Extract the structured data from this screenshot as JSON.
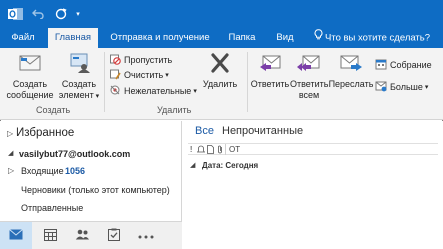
{
  "ribbon_tabs": [
    {
      "label": "Файл"
    },
    {
      "label": "Главная"
    },
    {
      "label": "Отправка и получение"
    },
    {
      "label": "Папка"
    },
    {
      "label": "Вид"
    }
  ],
  "tell_me": "Что вы хотите сделать?",
  "groups": {
    "create": {
      "label": "Создать",
      "new_message_line1": "Создать",
      "new_message_line2": "сообщение",
      "new_item_line1": "Создать",
      "new_item_line2": "элемент"
    },
    "delete": {
      "label": "Удалить",
      "ignore": "Пропустить",
      "clean_up": "Очистить",
      "junk": "Нежелательные",
      "delete": "Удалить"
    },
    "respond": {
      "reply": "Ответить",
      "reply_all_line1": "Ответить",
      "reply_all_line2": "всем",
      "forward": "Переслать",
      "meeting": "Собрание",
      "more": "Больше"
    }
  },
  "nav": {
    "favorites": "Избранное",
    "account": "vasilybut77@outlook.com",
    "inbox": "Входящие",
    "inbox_count": "1056",
    "drafts": "Черновики (только этот компьютер)",
    "sent": "Отправленные"
  },
  "list": {
    "filter_all": "Все",
    "filter_unread": "Непрочитанные",
    "col_from": "ОТ",
    "group_header": "Дата: Сегодня"
  },
  "colors": {
    "accent": "#0e6cc4",
    "ribbon_bg": "#f3f3f3",
    "active_tab_text": "#1b5aa5"
  }
}
